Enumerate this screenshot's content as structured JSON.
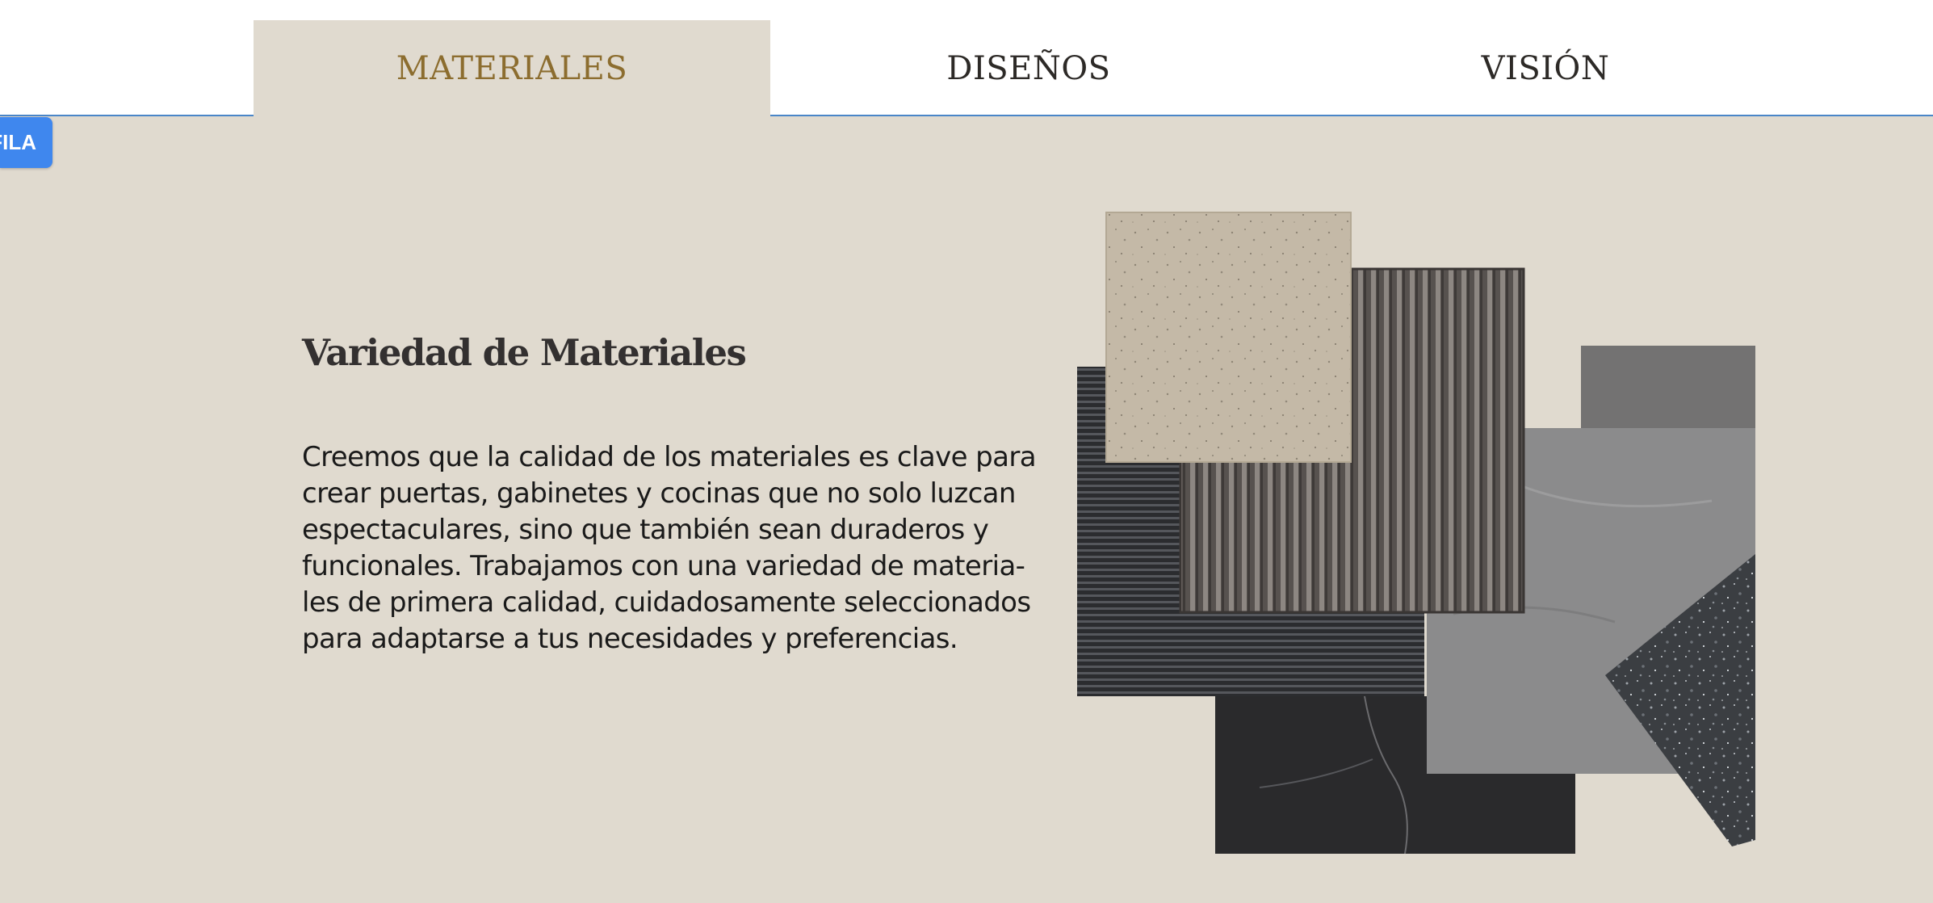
{
  "tabs": [
    {
      "label": "MATERIALES",
      "active": true
    },
    {
      "label": "DISEÑOS",
      "active": false
    },
    {
      "label": "VISIÓN",
      "active": false
    }
  ],
  "side_button": {
    "label": "FILA"
  },
  "content": {
    "heading": "Variedad de Materiales",
    "body": "Creemos que la calidad de los materiales es clave para crear puertas, gabinetes y cocinas que no solo luzcan espectaculares, sino que también sean duraderos y funcionales. Trabajamos con una variedad de materia-les de primera calidad, cuidadosamente seleccionados para adaptarse a tus necesidades y preferencias."
  },
  "colors": {
    "panel_bg": "#e0dacf",
    "active_tab_text": "#8c6d2f",
    "tab_text": "#2d2a27",
    "tab_line": "#4a86c8",
    "side_button_bg": "#3f87ee"
  },
  "image": {
    "subject": "material-samples-collage"
  }
}
